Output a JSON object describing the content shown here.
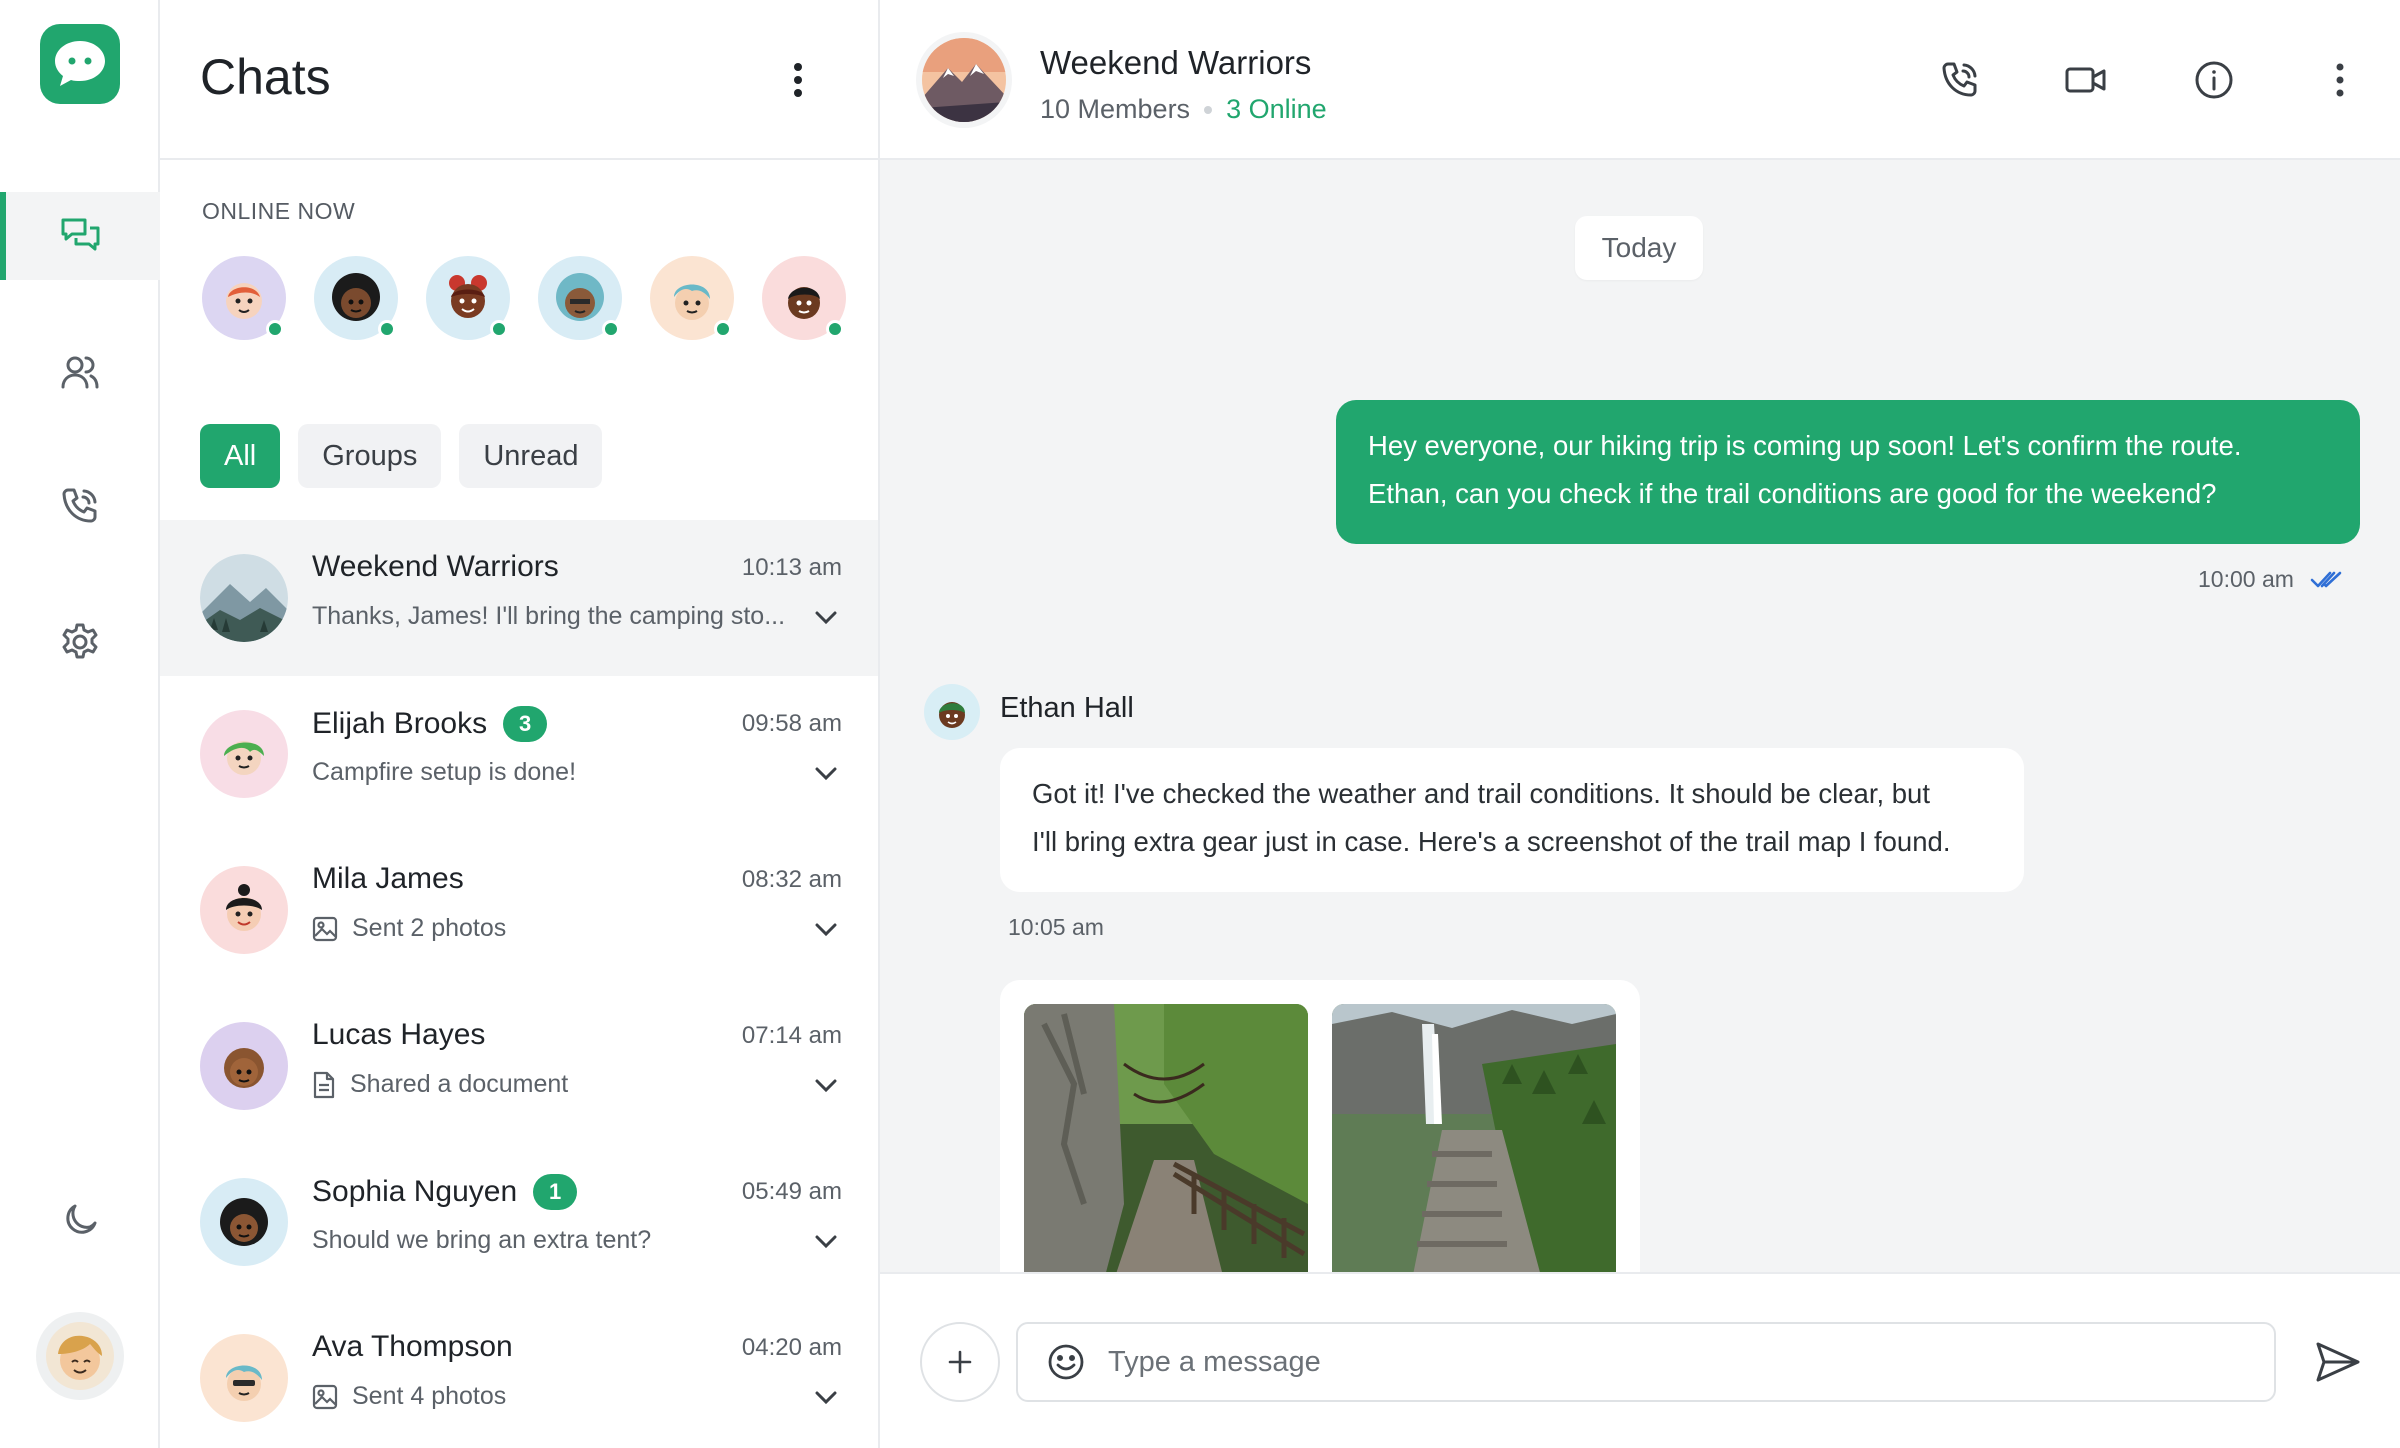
{
  "brand": {
    "accent": "#21a66e"
  },
  "rail": {
    "items": [
      {
        "icon": "chats-icon",
        "active": true
      },
      {
        "icon": "contacts-icon",
        "active": false
      },
      {
        "icon": "calls-icon",
        "active": false
      },
      {
        "icon": "settings-icon",
        "active": false
      }
    ],
    "bottom": {
      "theme_icon": "moon-icon",
      "profile": "user-avatar"
    }
  },
  "list": {
    "title": "Chats",
    "online_label": "ONLINE NOW",
    "online_users": 6,
    "filters": [
      "All",
      "Groups",
      "Unread"
    ],
    "active_filter": "All",
    "chats": [
      {
        "name": "Weekend Warriors",
        "time": "10:13 am",
        "preview": "Thanks, James! I'll bring the camping sto...",
        "badge": "",
        "attachment": "",
        "active": true
      },
      {
        "name": "Elijah Brooks",
        "time": "09:58 am",
        "preview": "Campfire setup is done!",
        "badge": "3",
        "attachment": ""
      },
      {
        "name": "Mila James",
        "time": "08:32 am",
        "preview": "Sent 2 photos",
        "badge": "",
        "attachment": "image-icon"
      },
      {
        "name": "Lucas Hayes",
        "time": "07:14 am",
        "preview": "Shared a document",
        "badge": "",
        "attachment": "document-icon"
      },
      {
        "name": "Sophia Nguyen",
        "time": "05:49 am",
        "preview": "Should we bring an extra tent?",
        "badge": "1",
        "attachment": ""
      },
      {
        "name": "Ava Thompson",
        "time": "04:20 am",
        "preview": "Sent 4 photos",
        "badge": "",
        "attachment": "image-icon"
      }
    ]
  },
  "conversation": {
    "name": "Weekend Warriors",
    "members": "10 Members",
    "online": "3 Online",
    "date": "Today",
    "outgoing": {
      "line1": "Hey everyone, our hiking trip is coming up soon! Let's confirm the route.",
      "line2": "Ethan, can you check if the trail conditions are good for the weekend?",
      "time": "10:00 am"
    },
    "incoming": {
      "sender": "Ethan Hall",
      "line1": "Got it! I've checked the weather and trail conditions. It should be clear, but",
      "line2": "I'll bring extra gear just in case. Here's a screenshot of the trail map I found.",
      "time": "10:05 am"
    },
    "composer": {
      "placeholder": "Type a message"
    }
  }
}
